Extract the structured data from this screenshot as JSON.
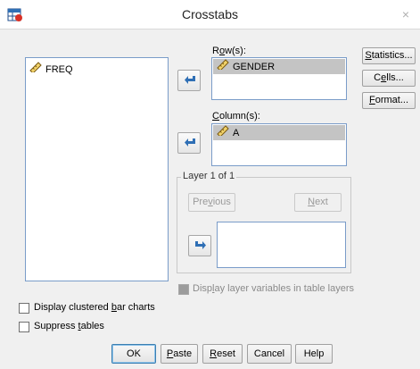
{
  "window": {
    "title": "Crosstabs",
    "close_glyph": "×",
    "app_icon": "spss-crosstabs-icon"
  },
  "source_list": {
    "items": [
      {
        "label": "FREQ",
        "icon": "scale-ruler-icon"
      }
    ]
  },
  "rows": {
    "label_prefix": "R",
    "label_underlined": "o",
    "label_suffix": "w(s):",
    "items": [
      {
        "label": "GENDER",
        "icon": "scale-ruler-icon"
      }
    ]
  },
  "columns": {
    "label_prefix": "",
    "label_underlined": "C",
    "label_suffix": "olumn(s):",
    "items": [
      {
        "label": "A",
        "icon": "scale-ruler-icon"
      }
    ]
  },
  "layer": {
    "caption": "Layer 1 of 1",
    "previous": {
      "prefix": "Pre",
      "underlined": "v",
      "suffix": "ious",
      "enabled": false
    },
    "next": {
      "prefix": "",
      "underlined": "N",
      "suffix": "ext",
      "enabled": false
    },
    "items": []
  },
  "side_buttons": [
    {
      "prefix": "",
      "underlined": "S",
      "suffix": "tatistics..."
    },
    {
      "prefix": "C",
      "underlined": "e",
      "suffix": "lls..."
    },
    {
      "prefix": "",
      "underlined": "F",
      "suffix": "ormat..."
    }
  ],
  "options": {
    "display_layer": {
      "prefix": "Disp",
      "underlined": "l",
      "suffix": "ay layer variables in table layers",
      "checked": false,
      "enabled": false
    },
    "clustered_bar": {
      "prefix": "Display clustered ",
      "underlined": "b",
      "suffix": "ar charts",
      "checked": false
    },
    "suppress_tables": {
      "prefix": "Suppress ",
      "underlined": "t",
      "suffix": "ables",
      "checked": false
    }
  },
  "footer_buttons": {
    "ok": {
      "prefix": "OK",
      "underlined": "",
      "suffix": ""
    },
    "paste": {
      "prefix": "",
      "underlined": "P",
      "suffix": "aste"
    },
    "reset": {
      "prefix": "",
      "underlined": "R",
      "suffix": "eset"
    },
    "cancel": {
      "prefix": "Cancel",
      "underlined": "",
      "suffix": ""
    },
    "help": {
      "prefix": "Help",
      "underlined": "",
      "suffix": ""
    }
  },
  "colors": {
    "accent": "#3c7fb1",
    "arrow_blue": "#2f6fb5",
    "selection": "#c4c4c4"
  }
}
